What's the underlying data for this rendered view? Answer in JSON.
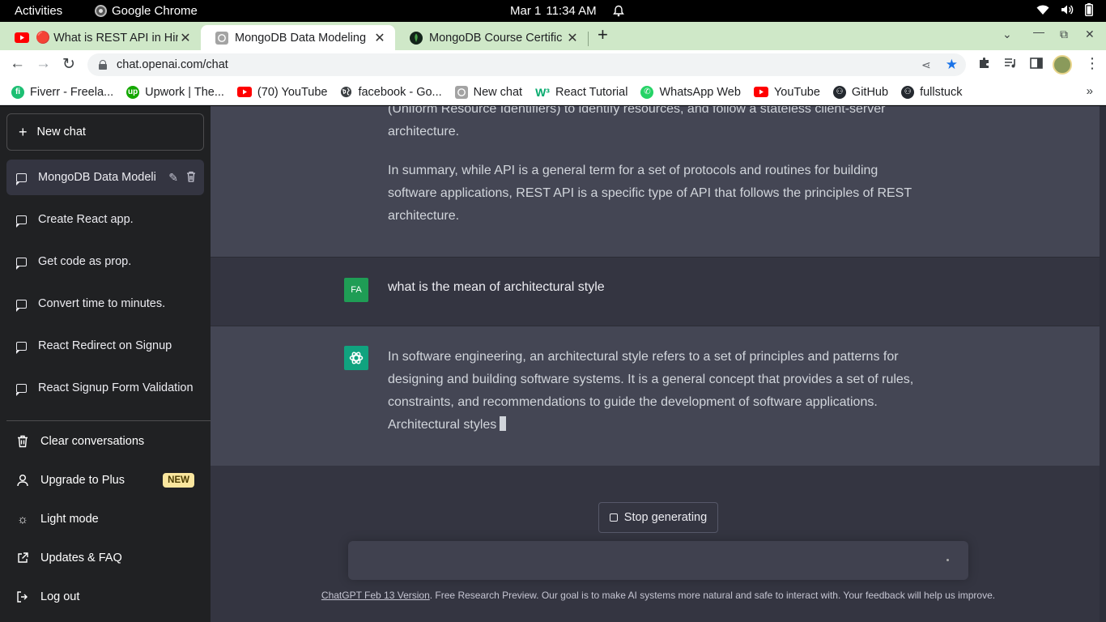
{
  "os": {
    "activities": "Activities",
    "app_name": "Google Chrome",
    "date": "Mar 1",
    "time": "11:34 AM"
  },
  "browser": {
    "tabs": [
      {
        "title": "🔴 What is REST API in Hin",
        "icon": "youtube-icon"
      },
      {
        "title": "MongoDB Data Modeling",
        "icon": "chatgpt-icon"
      },
      {
        "title": "MongoDB Course Certific",
        "icon": "mongodb-icon"
      }
    ],
    "url": "chat.openai.com/chat",
    "bookmarks": [
      {
        "label": "Fiverr - Freela...",
        "icon": "fiverr-icon",
        "color": "#1dbf73"
      },
      {
        "label": "Upwork | The...",
        "icon": "upwork-icon",
        "color": "#14a800"
      },
      {
        "label": "(70) YouTube",
        "icon": "youtube-icon",
        "color": "#ff0000"
      },
      {
        "label": "facebook - Go...",
        "icon": "globe-icon",
        "color": "#3c4043"
      },
      {
        "label": "New chat",
        "icon": "chatgpt-icon",
        "color": "#10a37f"
      },
      {
        "label": "React Tutorial",
        "icon": "w3schools-icon",
        "color": "#04aa6d"
      },
      {
        "label": "WhatsApp Web",
        "icon": "whatsapp-icon",
        "color": "#25d366"
      },
      {
        "label": "YouTube",
        "icon": "youtube-icon",
        "color": "#ff0000"
      },
      {
        "label": "GitHub",
        "icon": "github-icon",
        "color": "#24292f"
      },
      {
        "label": "fullstuck",
        "icon": "github-icon",
        "color": "#24292f"
      }
    ]
  },
  "sidebar": {
    "new_chat": "New chat",
    "conversations": [
      {
        "label": "MongoDB Data Modeli",
        "active": true
      },
      {
        "label": "Create React app."
      },
      {
        "label": "Get code as prop."
      },
      {
        "label": "Convert time to minutes."
      },
      {
        "label": "React Redirect on Signup"
      },
      {
        "label": "React Signup Form Validation"
      }
    ],
    "menu": [
      {
        "label": "Clear conversations",
        "icon": "trash-icon"
      },
      {
        "label": "Upgrade to Plus",
        "icon": "user-icon",
        "badge": "NEW"
      },
      {
        "label": "Light mode",
        "icon": "sun-icon"
      },
      {
        "label": "Updates & FAQ",
        "icon": "external-link-icon"
      },
      {
        "label": "Log out",
        "icon": "logout-icon"
      }
    ]
  },
  "chat": {
    "messages": [
      {
        "role": "assistant",
        "paragraphs": [
          "(Uniform Resource Identifiers) to identify resources, and follow a stateless client-server architecture.",
          "In summary, while API is a general term for a set of protocols and routines for building software applications, REST API is a specific type of API that follows the principles of REST architecture."
        ]
      },
      {
        "role": "user",
        "avatar": "FA",
        "text": "what is the mean of architectural style"
      },
      {
        "role": "assistant",
        "text": "In software engineering, an architectural style refers to a set of principles and patterns for designing and building software systems. It is a general concept that provides a set of rules, constraints, and recommendations to guide the development of software applications. Architectural styles"
      }
    ],
    "stop_button": "Stop generating",
    "input_placeholder": "",
    "footer_link": "ChatGPT Feb 13 Version",
    "footer_text": ". Free Research Preview. Our goal is to make AI systems more natural and safe to interact with. Your feedback will help us improve."
  }
}
